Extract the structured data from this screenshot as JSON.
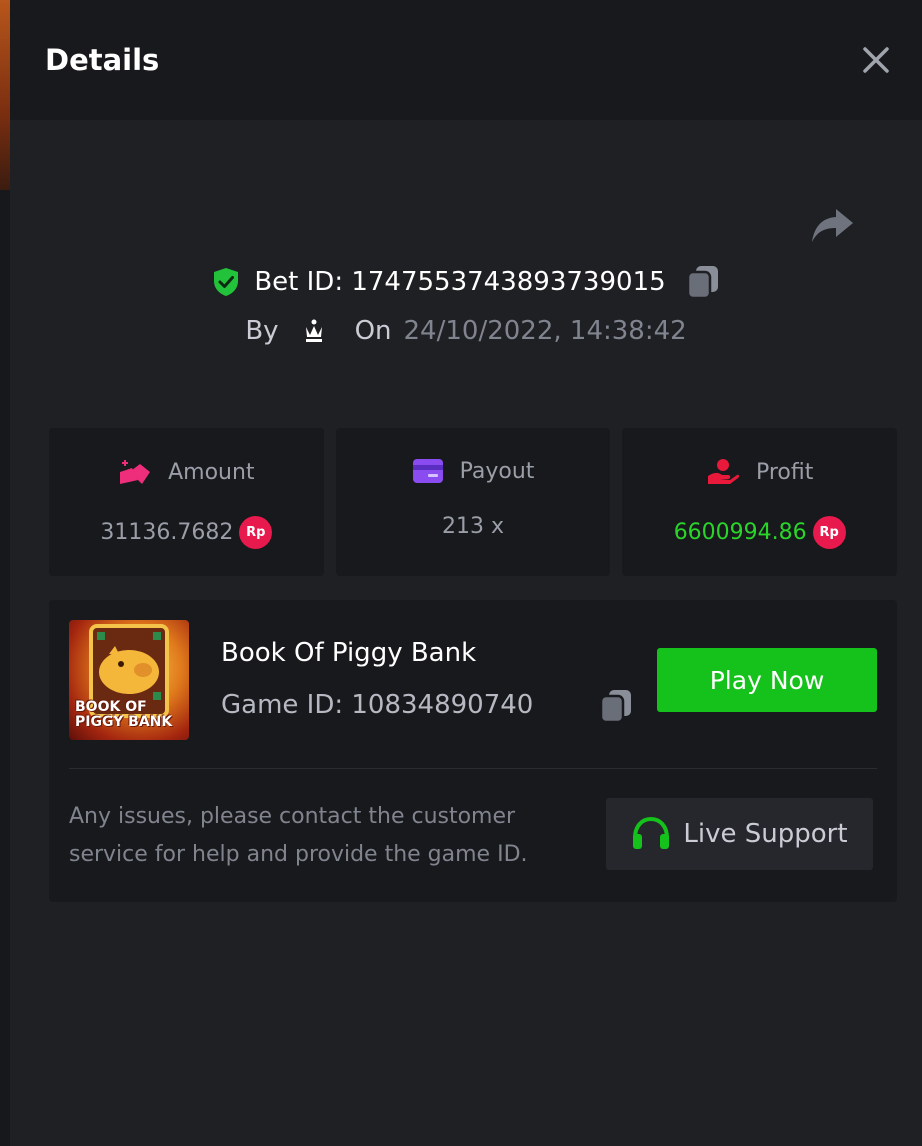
{
  "modal": {
    "title": "Details"
  },
  "bet": {
    "bet_id": "Bet ID: 1747553743893739015",
    "by_label": "By",
    "on_label": "On",
    "date": "24/10/2022, 14:38:42"
  },
  "stats": {
    "amount": {
      "label": "Amount",
      "value": "31136.7682",
      "currency": "Rp"
    },
    "payout": {
      "label": "Payout",
      "value": "213 x"
    },
    "profit": {
      "label": "Profit",
      "value": "6600994.86",
      "currency": "Rp"
    }
  },
  "game": {
    "thumbnail_text": "BOOK OF PIGGY BANK",
    "name": "Book Of Piggy Bank",
    "game_id": "Game ID: 10834890740",
    "play_label": "Play Now"
  },
  "support": {
    "text": "Any issues, please contact the customer service for help and provide the game ID.",
    "button_label": "Live Support"
  },
  "colors": {
    "header_bg": "#18191c",
    "page_bg": "#1f2024",
    "accent_green": "#15c11b",
    "profit_green": "#2ad52a",
    "currency_badge": "#e8194c",
    "shield_green": "#22c33a",
    "amount_icon": "#ee2e7a",
    "payout_icon": "#8a4cf0",
    "profit_icon": "#e8193a"
  },
  "icons": {
    "close": "close-icon",
    "share": "share-icon",
    "shield": "shield-check-icon",
    "copy": "copy-icon",
    "crown": "crown-icon",
    "amount": "coins-icon",
    "payout": "card-icon",
    "profit": "hand-coin-icon",
    "support": "headset-icon"
  }
}
